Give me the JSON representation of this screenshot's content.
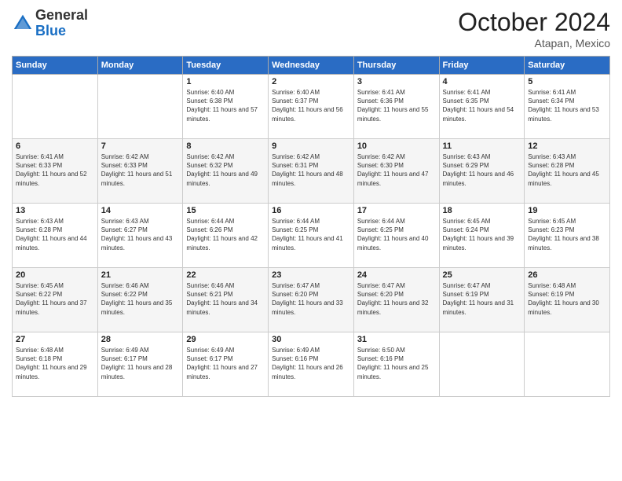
{
  "logo": {
    "general": "General",
    "blue": "Blue"
  },
  "title": "October 2024",
  "location": "Atapan, Mexico",
  "days_of_week": [
    "Sunday",
    "Monday",
    "Tuesday",
    "Wednesday",
    "Thursday",
    "Friday",
    "Saturday"
  ],
  "weeks": [
    [
      {
        "day": "",
        "info": ""
      },
      {
        "day": "",
        "info": ""
      },
      {
        "day": "1",
        "sunrise": "6:40 AM",
        "sunset": "6:38 PM",
        "daylight": "11 hours and 57 minutes."
      },
      {
        "day": "2",
        "sunrise": "6:40 AM",
        "sunset": "6:37 PM",
        "daylight": "11 hours and 56 minutes."
      },
      {
        "day": "3",
        "sunrise": "6:41 AM",
        "sunset": "6:36 PM",
        "daylight": "11 hours and 55 minutes."
      },
      {
        "day": "4",
        "sunrise": "6:41 AM",
        "sunset": "6:35 PM",
        "daylight": "11 hours and 54 minutes."
      },
      {
        "day": "5",
        "sunrise": "6:41 AM",
        "sunset": "6:34 PM",
        "daylight": "11 hours and 53 minutes."
      }
    ],
    [
      {
        "day": "6",
        "sunrise": "6:41 AM",
        "sunset": "6:33 PM",
        "daylight": "11 hours and 52 minutes."
      },
      {
        "day": "7",
        "sunrise": "6:42 AM",
        "sunset": "6:33 PM",
        "daylight": "11 hours and 51 minutes."
      },
      {
        "day": "8",
        "sunrise": "6:42 AM",
        "sunset": "6:32 PM",
        "daylight": "11 hours and 49 minutes."
      },
      {
        "day": "9",
        "sunrise": "6:42 AM",
        "sunset": "6:31 PM",
        "daylight": "11 hours and 48 minutes."
      },
      {
        "day": "10",
        "sunrise": "6:42 AM",
        "sunset": "6:30 PM",
        "daylight": "11 hours and 47 minutes."
      },
      {
        "day": "11",
        "sunrise": "6:43 AM",
        "sunset": "6:29 PM",
        "daylight": "11 hours and 46 minutes."
      },
      {
        "day": "12",
        "sunrise": "6:43 AM",
        "sunset": "6:28 PM",
        "daylight": "11 hours and 45 minutes."
      }
    ],
    [
      {
        "day": "13",
        "sunrise": "6:43 AM",
        "sunset": "6:28 PM",
        "daylight": "11 hours and 44 minutes."
      },
      {
        "day": "14",
        "sunrise": "6:43 AM",
        "sunset": "6:27 PM",
        "daylight": "11 hours and 43 minutes."
      },
      {
        "day": "15",
        "sunrise": "6:44 AM",
        "sunset": "6:26 PM",
        "daylight": "11 hours and 42 minutes."
      },
      {
        "day": "16",
        "sunrise": "6:44 AM",
        "sunset": "6:25 PM",
        "daylight": "11 hours and 41 minutes."
      },
      {
        "day": "17",
        "sunrise": "6:44 AM",
        "sunset": "6:25 PM",
        "daylight": "11 hours and 40 minutes."
      },
      {
        "day": "18",
        "sunrise": "6:45 AM",
        "sunset": "6:24 PM",
        "daylight": "11 hours and 39 minutes."
      },
      {
        "day": "19",
        "sunrise": "6:45 AM",
        "sunset": "6:23 PM",
        "daylight": "11 hours and 38 minutes."
      }
    ],
    [
      {
        "day": "20",
        "sunrise": "6:45 AM",
        "sunset": "6:22 PM",
        "daylight": "11 hours and 37 minutes."
      },
      {
        "day": "21",
        "sunrise": "6:46 AM",
        "sunset": "6:22 PM",
        "daylight": "11 hours and 35 minutes."
      },
      {
        "day": "22",
        "sunrise": "6:46 AM",
        "sunset": "6:21 PM",
        "daylight": "11 hours and 34 minutes."
      },
      {
        "day": "23",
        "sunrise": "6:47 AM",
        "sunset": "6:20 PM",
        "daylight": "11 hours and 33 minutes."
      },
      {
        "day": "24",
        "sunrise": "6:47 AM",
        "sunset": "6:20 PM",
        "daylight": "11 hours and 32 minutes."
      },
      {
        "day": "25",
        "sunrise": "6:47 AM",
        "sunset": "6:19 PM",
        "daylight": "11 hours and 31 minutes."
      },
      {
        "day": "26",
        "sunrise": "6:48 AM",
        "sunset": "6:19 PM",
        "daylight": "11 hours and 30 minutes."
      }
    ],
    [
      {
        "day": "27",
        "sunrise": "6:48 AM",
        "sunset": "6:18 PM",
        "daylight": "11 hours and 29 minutes."
      },
      {
        "day": "28",
        "sunrise": "6:49 AM",
        "sunset": "6:17 PM",
        "daylight": "11 hours and 28 minutes."
      },
      {
        "day": "29",
        "sunrise": "6:49 AM",
        "sunset": "6:17 PM",
        "daylight": "11 hours and 27 minutes."
      },
      {
        "day": "30",
        "sunrise": "6:49 AM",
        "sunset": "6:16 PM",
        "daylight": "11 hours and 26 minutes."
      },
      {
        "day": "31",
        "sunrise": "6:50 AM",
        "sunset": "6:16 PM",
        "daylight": "11 hours and 25 minutes."
      },
      {
        "day": "",
        "info": ""
      },
      {
        "day": "",
        "info": ""
      }
    ]
  ]
}
